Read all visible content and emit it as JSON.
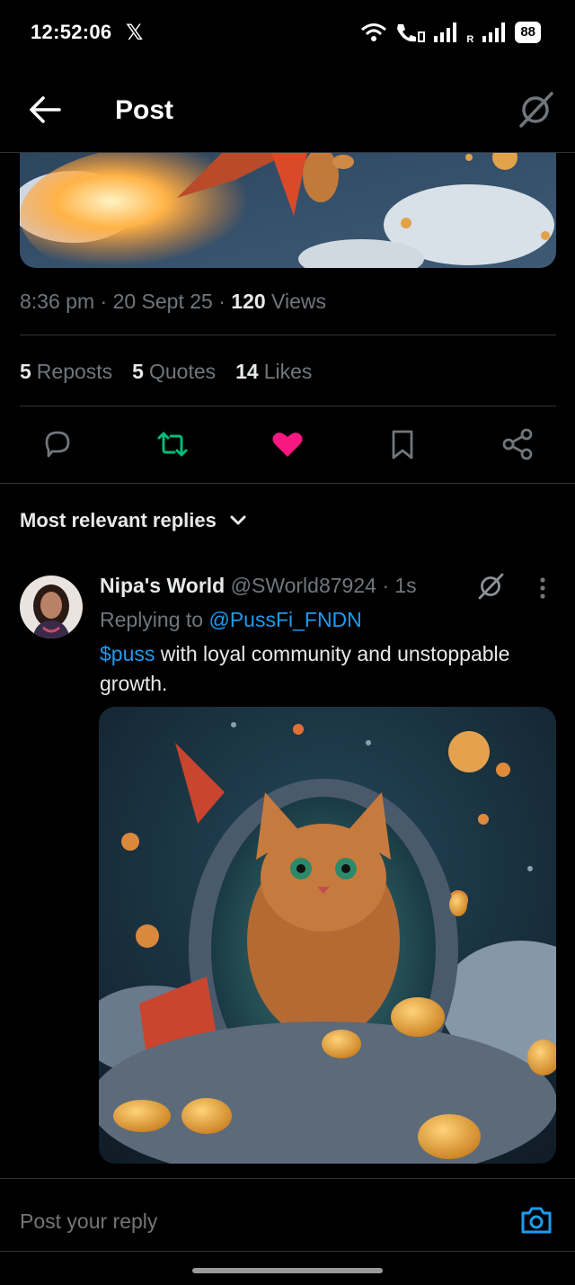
{
  "status_bar": {
    "time": "12:52:06",
    "x_logo": "𝕏",
    "battery": "88",
    "carrier_label": "R"
  },
  "header": {
    "title": "Post"
  },
  "post": {
    "time": "8:36 pm",
    "date": "20 Sept 25",
    "views_count": "120",
    "views_label": "Views",
    "reposts_count": "5",
    "reposts_label": "Reposts",
    "quotes_count": "5",
    "quotes_label": "Quotes",
    "likes_count": "14",
    "likes_label": "Likes",
    "liked": true,
    "reposted": true
  },
  "sort": {
    "label": "Most relevant replies"
  },
  "reply": {
    "name": "Nipa's World",
    "handle": "@SWorld87924",
    "age": "1s",
    "replying_prefix": "Replying to",
    "replying_to": "@PussFi_FNDN",
    "cashtag": "$puss",
    "text": " with loyal community and unstoppable growth."
  },
  "composer": {
    "placeholder": "Post your reply"
  },
  "colors": {
    "accent": "#1d9bf0",
    "like": "#f91880",
    "repost": "#00ba7c",
    "muted": "#71767b",
    "text": "#e7e9ea",
    "divider": "#2f3336"
  }
}
